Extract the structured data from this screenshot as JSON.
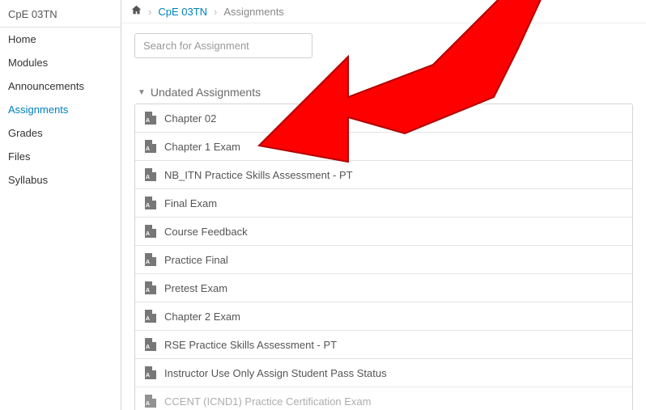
{
  "course_code": "CpE 03TN",
  "sidebar": {
    "items": [
      {
        "label": "Home",
        "active": false
      },
      {
        "label": "Modules",
        "active": false
      },
      {
        "label": "Announcements",
        "active": false
      },
      {
        "label": "Assignments",
        "active": true
      },
      {
        "label": "Grades",
        "active": false
      },
      {
        "label": "Files",
        "active": false
      },
      {
        "label": "Syllabus",
        "active": false
      }
    ]
  },
  "breadcrumb": {
    "course_link": "CpE 03TN",
    "current": "Assignments"
  },
  "search": {
    "placeholder": "Search for Assignment"
  },
  "group": {
    "title": "Undated Assignments",
    "items": [
      "Chapter 02",
      "Chapter 1 Exam",
      "NB_ITN Practice Skills Assessment - PT",
      "Final Exam",
      "Course Feedback",
      "Practice Final",
      "Pretest Exam",
      "Chapter 2 Exam",
      "RSE Practice Skills Assessment - PT",
      "Instructor Use Only Assign Student Pass Status",
      "CCENT (ICND1) Practice Certification Exam"
    ]
  },
  "annotation": {
    "arrow_color": "#ff0000",
    "arrow_target": "Chapter 1 Exam"
  }
}
